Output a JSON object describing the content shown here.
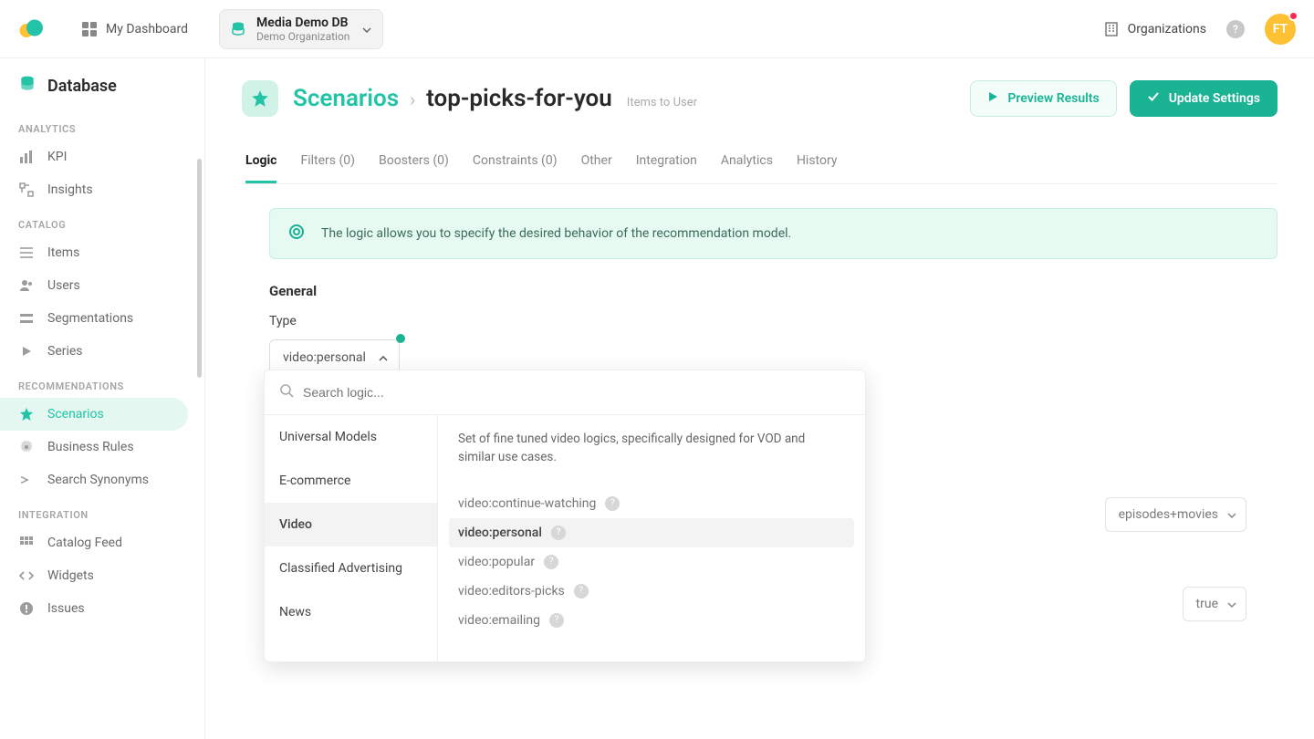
{
  "header": {
    "dashboard": "My Dashboard",
    "db_name": "Media Demo DB",
    "db_org": "Demo Organization",
    "organizations": "Organizations",
    "avatar": "FT"
  },
  "sidebar": {
    "title": "Database",
    "sections": {
      "analytics": "ANALYTICS",
      "catalog": "CATALOG",
      "recommendations": "RECOMMENDATIONS",
      "integration": "INTEGRATION"
    },
    "items": {
      "kpi": "KPI",
      "insights": "Insights",
      "items": "Items",
      "users": "Users",
      "segmentations": "Segmentations",
      "series": "Series",
      "scenarios": "Scenarios",
      "business_rules": "Business Rules",
      "search_synonyms": "Search Synonyms",
      "catalog_feed": "Catalog Feed",
      "widgets": "Widgets",
      "issues": "Issues"
    }
  },
  "page": {
    "root": "Scenarios",
    "leaf": "top-picks-for-you",
    "hint": "Items to User",
    "preview": "Preview Results",
    "update": "Update Settings"
  },
  "tabs": {
    "logic": "Logic",
    "filters": "Filters (0)",
    "boosters": "Boosters (0)",
    "constraints": "Constraints (0)",
    "other": "Other",
    "integration": "Integration",
    "analytics": "Analytics",
    "history": "History"
  },
  "content": {
    "info": "The logic allows you to specify the desired behavior of the recommendation model.",
    "general": "General",
    "type_label": "Type",
    "type_value": "video:personal",
    "right_select1": "episodes+movies",
    "right_select2": "true"
  },
  "dropdown": {
    "search_placeholder": "Search logic...",
    "categories": {
      "universal": "Universal Models",
      "ecommerce": "E-commerce",
      "video": "Video",
      "classified": "Classified Advertising",
      "news": "News"
    },
    "description": "Set of fine tuned video logics, specifically designed for VOD and similar use cases.",
    "options": {
      "o1": "video:continue-watching",
      "o2": "video:personal",
      "o3": "video:popular",
      "o4": "video:editors-picks",
      "o5": "video:emailing"
    }
  }
}
